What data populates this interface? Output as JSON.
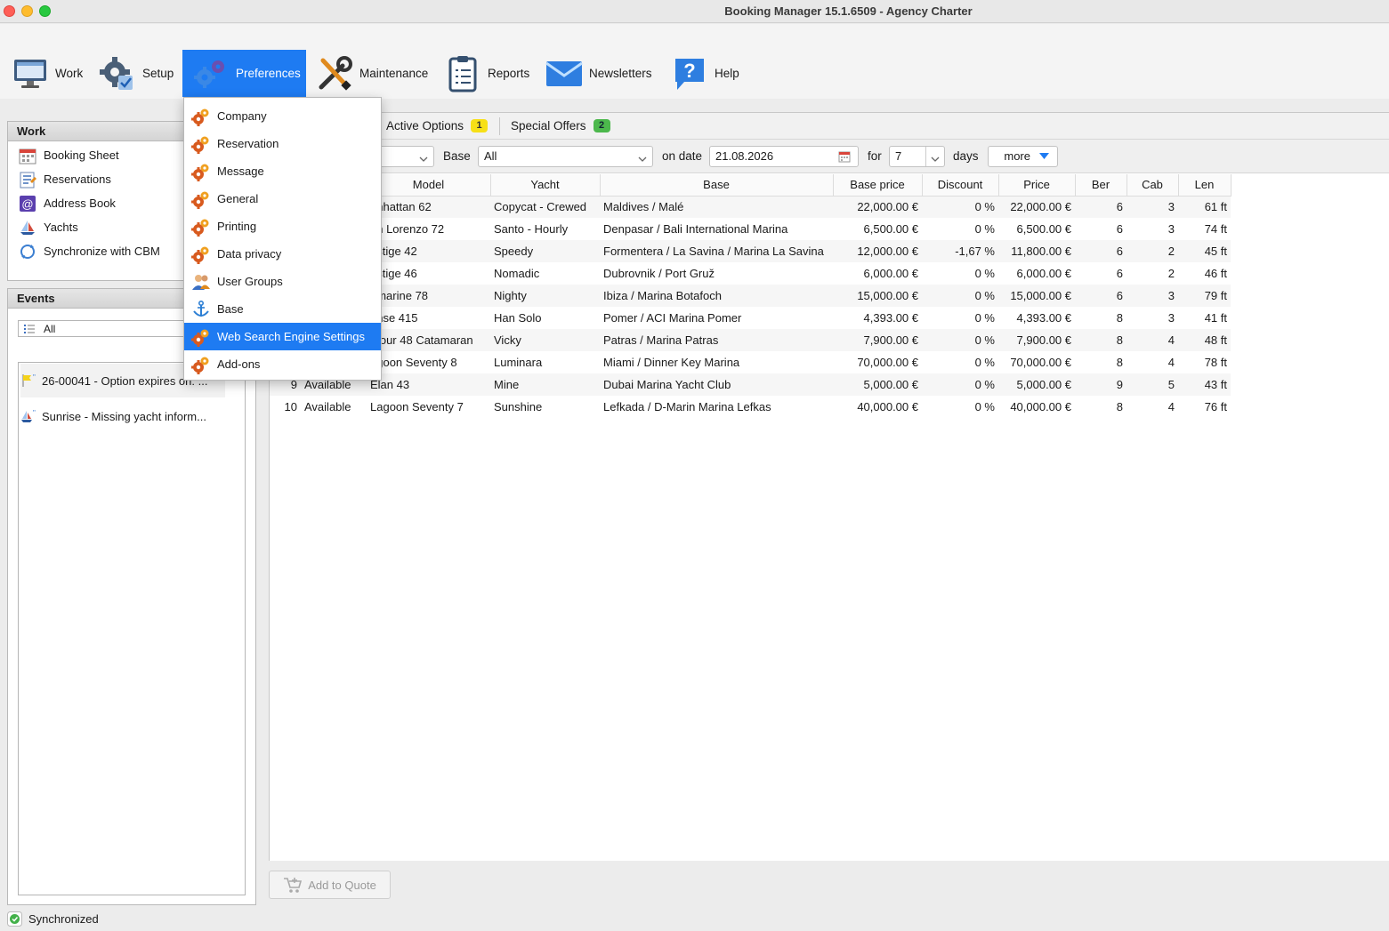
{
  "window": {
    "title": "Booking Manager 15.1.6509 - Agency Charter"
  },
  "toolbar": {
    "items": [
      {
        "label": "Work",
        "icon": "monitor-icon"
      },
      {
        "label": "Setup",
        "icon": "gear-check-icon"
      },
      {
        "label": "Preferences",
        "icon": "gears-icon"
      },
      {
        "label": "Maintenance",
        "icon": "wrench-screwdriver-icon"
      },
      {
        "label": "Reports",
        "icon": "clipboard-icon"
      },
      {
        "label": "Newsletters",
        "icon": "envelope-icon"
      },
      {
        "label": "Help",
        "icon": "help-question-icon"
      }
    ]
  },
  "work_panel": {
    "title": "Work",
    "items": [
      {
        "label": "Booking Sheet",
        "icon": "calendar-icon"
      },
      {
        "label": "Reservations",
        "icon": "list-doc-icon"
      },
      {
        "label": "Address Book",
        "icon": "at-sign-icon"
      },
      {
        "label": "Yachts",
        "icon": "sailboat-icon"
      },
      {
        "label": "Synchronize with CBM",
        "icon": "sync-icon"
      }
    ]
  },
  "events_panel": {
    "title": "Events",
    "filter": "All",
    "items": [
      {
        "text": "26-00041 - Option expires on: ...",
        "icon": "flag-icon"
      },
      {
        "text": "Sunrise - Missing yacht inform...",
        "icon": "boat-icon"
      }
    ]
  },
  "tabs": {
    "active_options": {
      "label": "Active Options",
      "count": "1"
    },
    "special_offers": {
      "label": "Special Offers",
      "count": "2"
    }
  },
  "filters": {
    "base_label": "Base",
    "base_value": "All",
    "on_date_label": "on date",
    "date_value": "21.08.2026",
    "for_label": "for",
    "days_value": "7",
    "days_label": "days",
    "more_label": "more"
  },
  "table": {
    "columns": [
      "Model",
      "Yacht",
      "Base",
      "Base price",
      "Discount",
      "Price",
      "Ber",
      "Cab",
      "Len"
    ],
    "rows": [
      {
        "num": "",
        "status": "",
        "model": "anhattan 62",
        "yacht": "Copycat - Crewed",
        "base": "Maldives / Malé",
        "base_price": "22,000.00 €",
        "discount": "0 %",
        "price": "22,000.00 €",
        "ber": "6",
        "cab": "3",
        "len": "61 ft"
      },
      {
        "num": "",
        "status": "",
        "model": "an Lorenzo 72",
        "yacht": "Santo - Hourly",
        "base": "Denpasar / Bali International Marina",
        "base_price": "6,500.00 €",
        "discount": "0 %",
        "price": "6,500.00 €",
        "ber": "6",
        "cab": "3",
        "len": "74 ft"
      },
      {
        "num": "",
        "status": "",
        "model": "estige 42",
        "yacht": "Speedy",
        "base": "Formentera / La Savina / Marina La Savina",
        "base_price": "12,000.00 €",
        "discount": "-1,67 %",
        "price": "11,800.00 €",
        "ber": "6",
        "cab": "2",
        "len": "45 ft"
      },
      {
        "num": "",
        "status": "",
        "model": "estige 46",
        "yacht": "Nomadic",
        "base": "Dubrovnik / Port Gruž",
        "base_price": "6,000.00 €",
        "discount": "0 %",
        "price": "6,000.00 €",
        "ber": "6",
        "cab": "2",
        "len": "46 ft"
      },
      {
        "num": "",
        "status": "",
        "model": "amarine 78",
        "yacht": "Nighty",
        "base": "Ibiza / Marina Botafoch",
        "base_price": "15,000.00 €",
        "discount": "0 %",
        "price": "15,000.00 €",
        "ber": "6",
        "cab": "3",
        "len": "79 ft"
      },
      {
        "num": "",
        "status": "",
        "model": "anse 415",
        "yacht": "Han Solo",
        "base": "Pomer / ACI Marina Pomer",
        "base_price": "4,393.00 €",
        "discount": "0 %",
        "price": "4,393.00 €",
        "ber": "8",
        "cab": "3",
        "len": "41 ft"
      },
      {
        "num": "",
        "status": "",
        "model": "ufour 48 Catamaran",
        "yacht": "Vicky",
        "base": "Patras / Marina Patras",
        "base_price": "7,900.00 €",
        "discount": "0 %",
        "price": "7,900.00 €",
        "ber": "8",
        "cab": "4",
        "len": "48 ft"
      },
      {
        "num": "",
        "status": "",
        "model": "agoon Seventy 8",
        "yacht": "Luminara",
        "base": "Miami / Dinner Key Marina",
        "base_price": "70,000.00 €",
        "discount": "0 %",
        "price": "70,000.00 €",
        "ber": "8",
        "cab": "4",
        "len": "78 ft"
      },
      {
        "num": "9",
        "status": "Available",
        "model": "Elan 43",
        "yacht": "Mine",
        "base": "Dubai Marina Yacht Club",
        "base_price": "5,000.00 €",
        "discount": "0 %",
        "price": "5,000.00 €",
        "ber": "9",
        "cab": "5",
        "len": "43 ft"
      },
      {
        "num": "10",
        "status": "Available",
        "model": "Lagoon Seventy 7",
        "yacht": "Sunshine",
        "base": "Lefkada / D-Marin Marina Lefkas",
        "base_price": "40,000.00 €",
        "discount": "0 %",
        "price": "40,000.00 €",
        "ber": "8",
        "cab": "4",
        "len": "76 ft"
      }
    ]
  },
  "add_to_quote": "Add to Quote",
  "status": {
    "text": "Synchronized"
  },
  "preferences_menu": {
    "items": [
      {
        "label": "Company",
        "icon": "gears-icon"
      },
      {
        "label": "Reservation",
        "icon": "gears-icon"
      },
      {
        "label": "Message",
        "icon": "gears-icon"
      },
      {
        "label": "General",
        "icon": "gears-icon"
      },
      {
        "label": "Printing",
        "icon": "gears-icon"
      },
      {
        "label": "Data privacy",
        "icon": "gears-icon"
      },
      {
        "label": "User Groups",
        "icon": "users-icon"
      },
      {
        "label": "Base",
        "icon": "anchor-icon"
      },
      {
        "label": "Web Search Engine Settings",
        "icon": "gears-icon"
      },
      {
        "label": "Add-ons",
        "icon": "gears-icon"
      }
    ],
    "selected_index": 8
  },
  "colors": {
    "accent": "#1e7bf2",
    "badge_yellow": "#f7e017",
    "badge_green": "#4cb84c"
  }
}
